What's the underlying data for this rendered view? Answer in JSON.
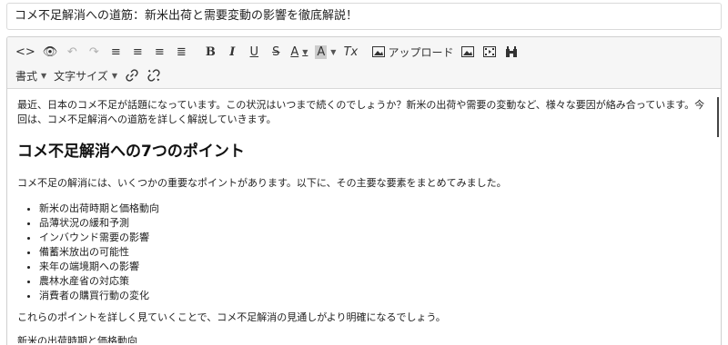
{
  "title_field": {
    "value": "コメ不足解消への道筋：新米出荷と需要変動の影響を徹底解説！"
  },
  "toolbar": {
    "row1": [
      {
        "name": "source-code-button",
        "glyph": "<>",
        "dim": false
      },
      {
        "name": "preview-button",
        "glyph": "👁",
        "dim": false
      },
      {
        "name": "undo-button",
        "glyph": "↶",
        "dim": true
      },
      {
        "name": "redo-button",
        "glyph": "↷",
        "dim": true
      },
      {
        "name": "align-left-button",
        "glyph": "≡",
        "dim": false
      },
      {
        "name": "align-center-button",
        "glyph": "≡",
        "dim": false
      },
      {
        "name": "align-right-button",
        "glyph": "≡",
        "dim": false
      },
      {
        "name": "align-justify-button",
        "glyph": "≣",
        "dim": false
      }
    ],
    "bold": "B",
    "italic": "I",
    "underline": "U",
    "strike": "S",
    "text_color": "A",
    "bg_color": "A",
    "clear_format": "Tx",
    "upload_label": "アップロード",
    "format_label": "書式",
    "font_size_label": "文字サイズ"
  },
  "content": {
    "intro": "最近、日本のコメ不足が話題になっています。この状況はいつまで続くのでしょうか？新米の出荷や需要の変動など、様々な要因が絡み合っています。今回は、コメ不足解消への道筋を詳しく解説していきます。",
    "heading": "コメ不足解消への7つのポイント",
    "lead": "コメ不足の解消には、いくつかの重要なポイントがあります。以下に、その主要な要素をまとめてみました。",
    "list": [
      "新米の出荷時期と価格動向",
      "品薄状況の緩和予測",
      "インバウンド需要の影響",
      "備蓄米放出の可能性",
      "来年の端境期への影響",
      "農林水産省の対応策",
      "消費者の購買行動の変化"
    ],
    "outro": "これらのポイントを詳しく見ていくことで、コメ不足解消の見通しがより明確になるでしょう。",
    "next_heading_partial": "新米の出荷時期と価格動向"
  }
}
